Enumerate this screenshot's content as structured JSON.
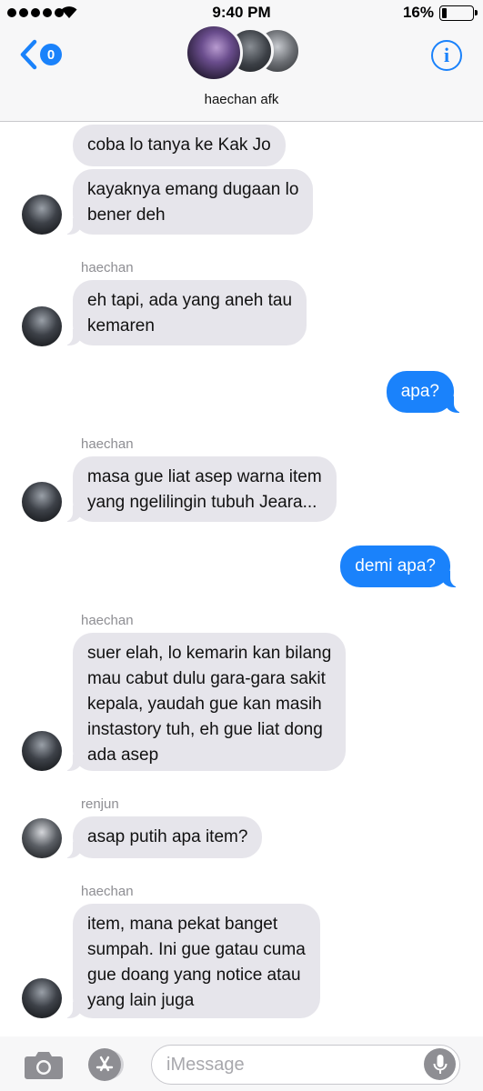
{
  "status_bar": {
    "time": "9:40 PM",
    "battery_percent": "16%",
    "battery_level": 0.16,
    "signal_bars": 5,
    "wifi_icon": "wifi-icon"
  },
  "header": {
    "back_badge": "0",
    "group_name": "haechan afk",
    "info_label": "i"
  },
  "messages": [
    {
      "type": "in",
      "text_lines": [
        "coba lo tanya ke Kak Jo"
      ]
    },
    {
      "type": "in",
      "text_lines": [
        "kayaknya emang dugaan lo",
        "bener deh"
      ]
    },
    {
      "sender": "haechan"
    },
    {
      "type": "in",
      "text_lines": [
        "eh tapi, ada yang aneh tau",
        "kemaren"
      ]
    },
    {
      "type": "out",
      "text_lines": [
        "apa?"
      ]
    },
    {
      "sender": "haechan"
    },
    {
      "type": "in",
      "text_lines": [
        "masa gue liat asep warna item",
        "yang ngelilingin tubuh Jeara..."
      ]
    },
    {
      "type": "out",
      "text_lines": [
        "demi apa?"
      ]
    },
    {
      "sender": "haechan"
    },
    {
      "type": "in",
      "text_lines": [
        "suer elah, lo kemarin kan bilang",
        "mau cabut dulu gara-gara sakit",
        "kepala, yaudah gue kan masih",
        "instastory tuh, eh gue liat dong",
        "ada asep"
      ]
    },
    {
      "sender": "renjun"
    },
    {
      "type": "in",
      "text_lines": [
        "asap putih apa item?"
      ]
    },
    {
      "sender": "haechan"
    },
    {
      "type": "in",
      "text_lines": [
        "item, mana pekat banget",
        "sumpah. Ini gue gatau cuma",
        "gue doang yang notice atau",
        "yang lain juga"
      ]
    }
  ],
  "composer": {
    "placeholder": "iMessage"
  },
  "colors": {
    "accent": "#1a82fb",
    "incoming_bubble": "#e6e5eb",
    "outgoing_bubble": "#1a82fb",
    "sender_label": "#8e8e93"
  }
}
